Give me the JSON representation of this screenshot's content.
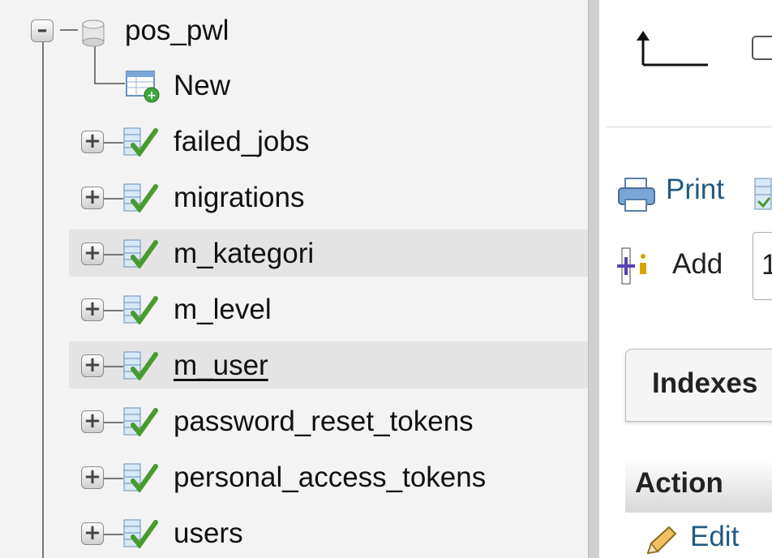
{
  "nav": {
    "database": {
      "name": "pos_pwl",
      "expanded": true
    },
    "new_label": "New",
    "tables": [
      {
        "name": "failed_jobs"
      },
      {
        "name": "migrations"
      },
      {
        "name": "m_kategori",
        "highlighted": true
      },
      {
        "name": "m_level"
      },
      {
        "name": "m_user",
        "highlighted": true,
        "hovered": true
      },
      {
        "name": "password_reset_tokens"
      },
      {
        "name": "personal_access_tokens"
      },
      {
        "name": "users"
      }
    ]
  },
  "right": {
    "print_label": "Print",
    "add_label": "Add",
    "add_value": "1",
    "indexes_label": "Indexes",
    "action_header": "Action",
    "edit_label": "Edit"
  },
  "colors": {
    "nav_bg": "#f3f3f3",
    "row_highlight": "#e4e4e4",
    "link": "#235a81"
  }
}
